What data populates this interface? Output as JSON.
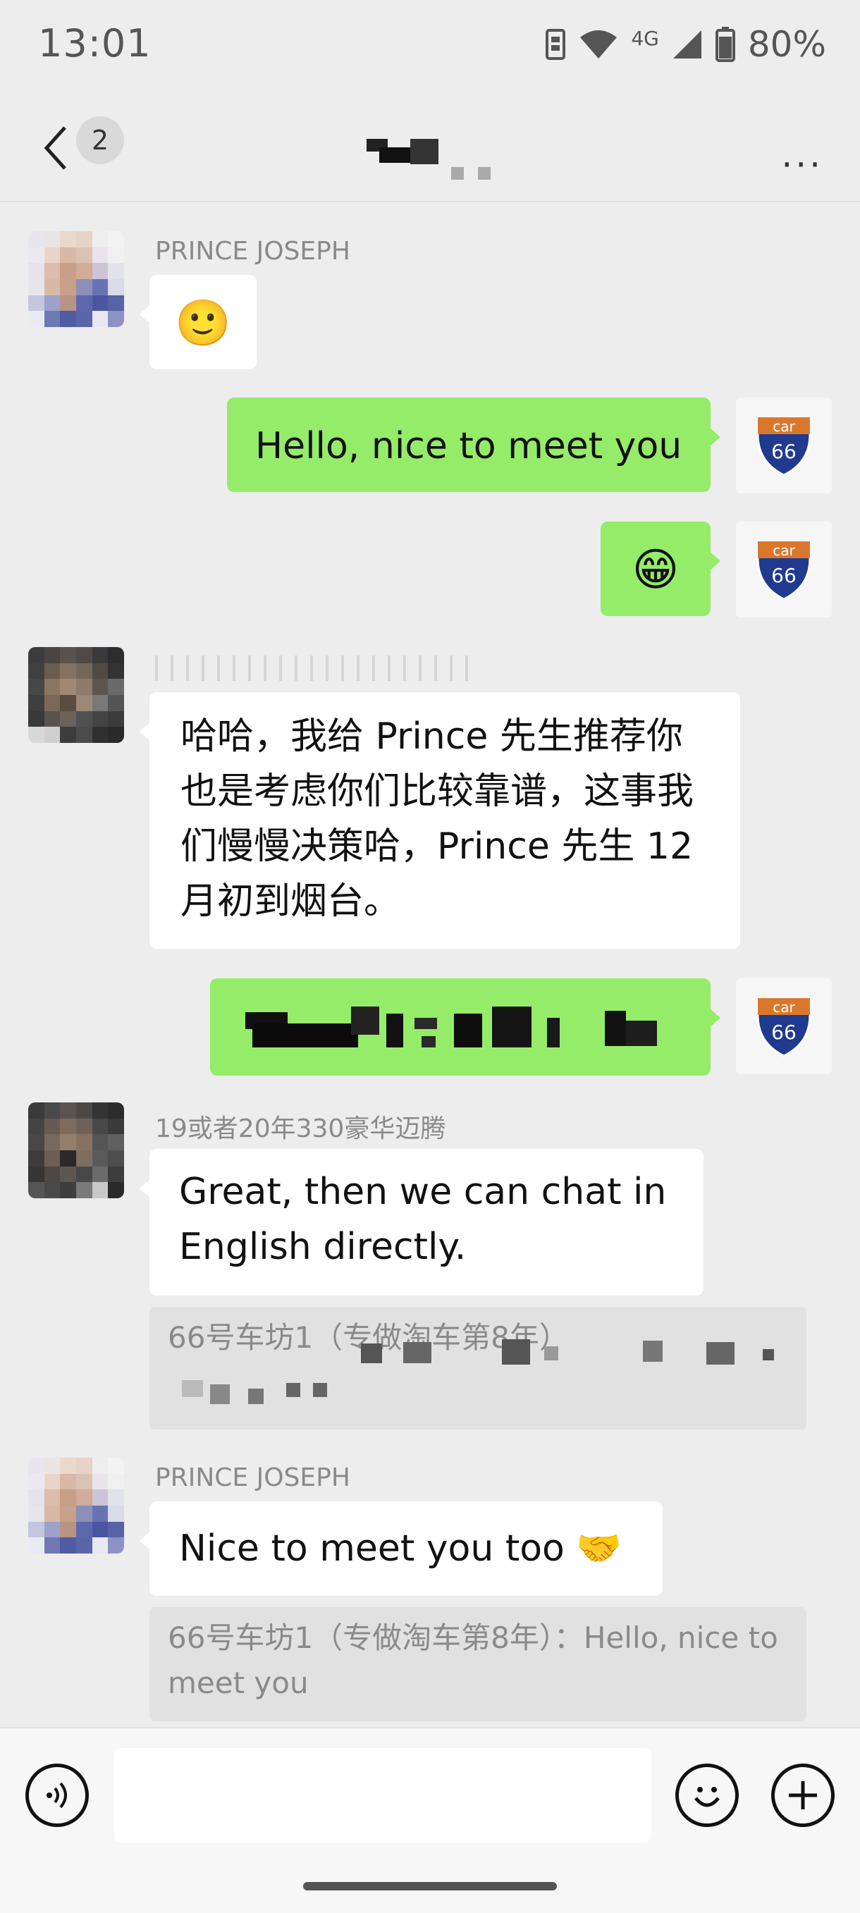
{
  "status_bar": {
    "time": "13:01",
    "network": "4G",
    "battery": "80%"
  },
  "header": {
    "back_count": "2",
    "more": "···"
  },
  "messages": {
    "m1": {
      "sender": "PRINCE JOSEPH",
      "emoji": "🙂"
    },
    "m2": {
      "text": "Hello, nice to meet you"
    },
    "m3": {
      "emoji": "😁"
    },
    "m4": {
      "text": "哈哈，我给 Prince 先生推荐你也是考虑你们比较靠谱，这事我们慢慢决策哈，Prince 先生 12 月初到烟台。"
    },
    "m6": {
      "sender": "19或者20年330豪华迈腾",
      "text": "Great, then we can chat in English directly.",
      "quote": "66号车坊1（专做淘车第8年）"
    },
    "m7": {
      "sender": "PRINCE JOSEPH",
      "text": "Nice to meet you too 🤝",
      "quote": "66号车坊1（专做淘车第8年）：Hello, nice to meet you"
    }
  },
  "icons": {
    "voice": "voice-icon",
    "emoji": "emoji-icon",
    "add": "plus-icon"
  },
  "colors": {
    "outgoing_bubble": "#95ec69",
    "incoming_bubble": "#ffffff",
    "background": "#ededed"
  },
  "car_avatar": {
    "top": "car",
    "number": "66"
  }
}
